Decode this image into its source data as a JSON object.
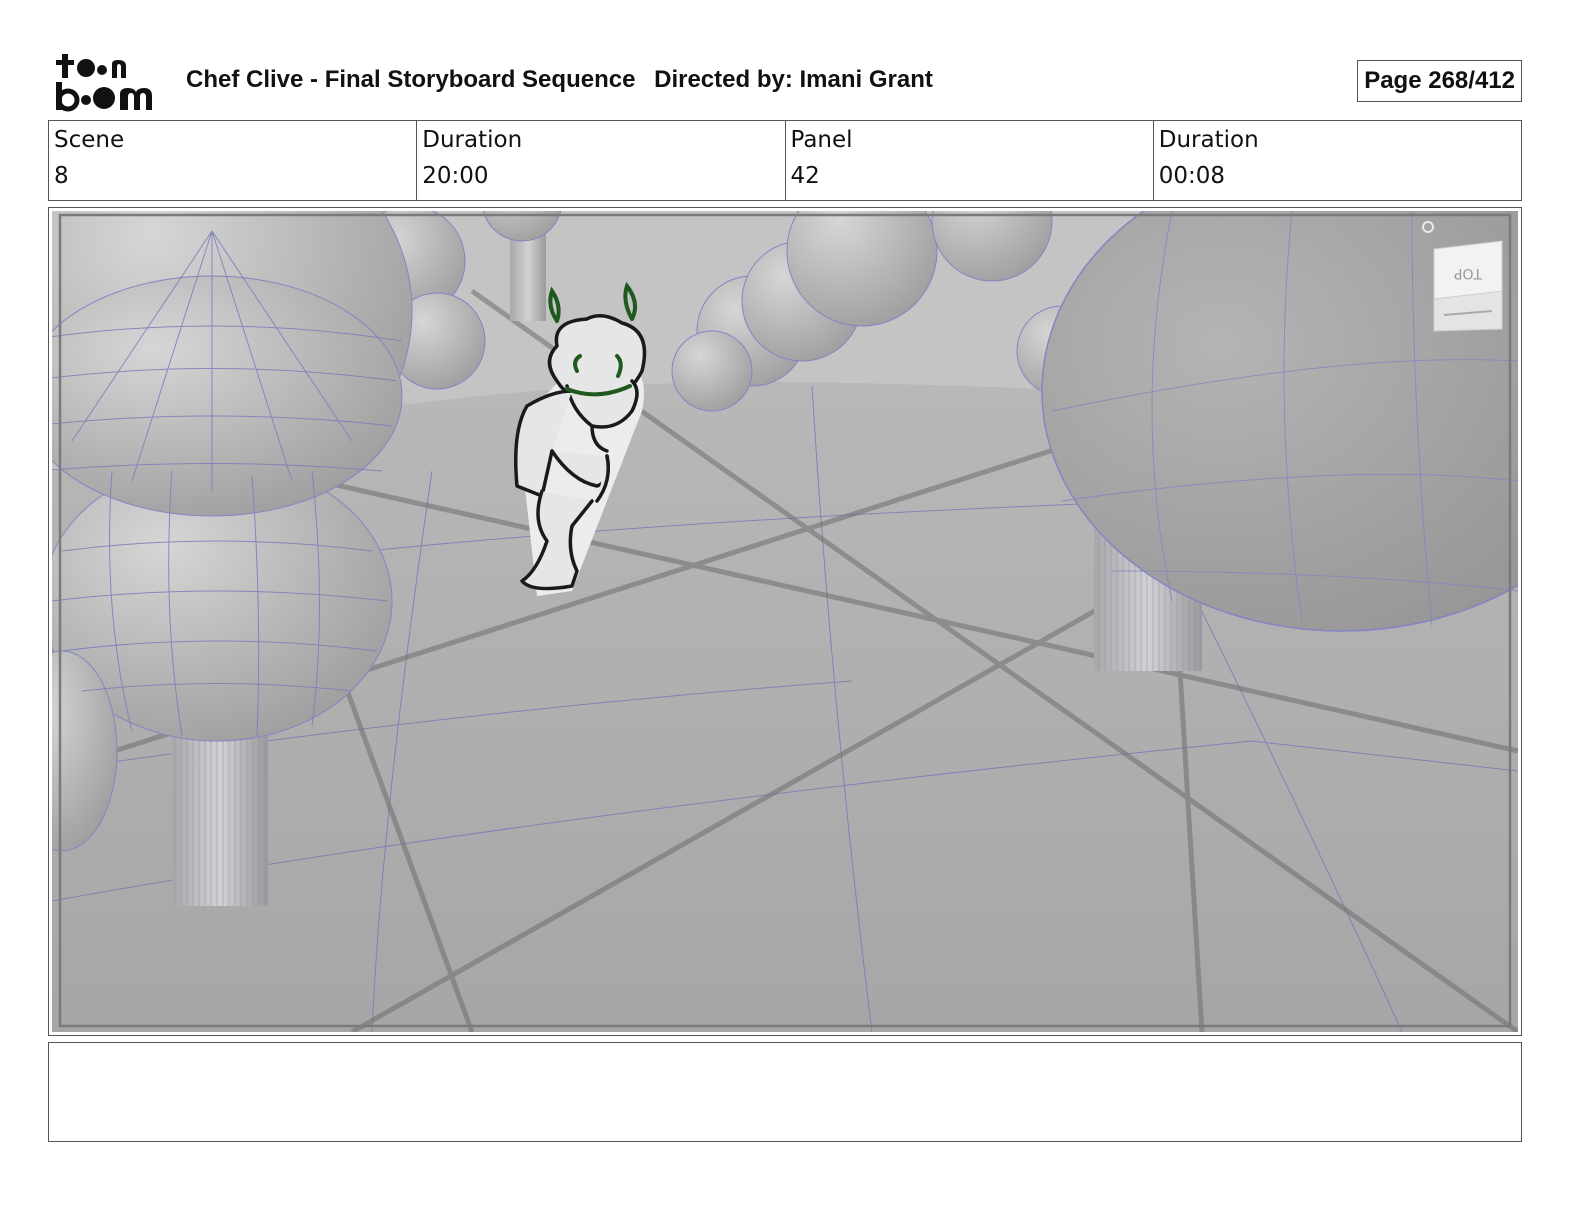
{
  "header": {
    "logo_text_top": "toon",
    "logo_text_bottom": "boom",
    "project_title": "Chef Clive - Final Storyboard Sequence",
    "director_credit": "Directed by: Imani Grant",
    "page_indicator": "Page 268/412"
  },
  "info": [
    {
      "label": "Scene",
      "value": "8"
    },
    {
      "label": "Duration",
      "value": "20:00"
    },
    {
      "label": "Panel",
      "value": "42"
    },
    {
      "label": "Duration",
      "value": "00:08"
    }
  ],
  "panel": {
    "view_cube_label": "TOP"
  },
  "notes": ""
}
